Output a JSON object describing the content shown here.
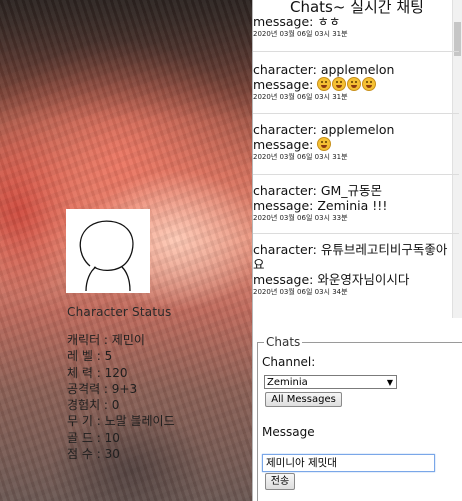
{
  "chat": {
    "header": "Chats~ 실시간 채팅",
    "messages": [
      {
        "character": "",
        "message": "message: ㅎㅎ",
        "time": "2020년 03월 06일 03시 31분"
      },
      {
        "character": "character: applemelon",
        "message": "message: ",
        "emoji": [
          "grinning-emoji",
          "grinning-emoji",
          "grinning-emoji",
          "grinning-emoji"
        ],
        "time": "2020년 03월 06일 03시 31분"
      },
      {
        "character": "character: applemelon",
        "message": "message: ",
        "emoji": [
          "cat-emoji"
        ],
        "time": "2020년 03월 06일 03시 31분"
      },
      {
        "character": "character: GM_규동몬",
        "message": "message: Zeminia !!!",
        "time": "2020년 03월 06일 03시 33분"
      },
      {
        "character": "character: 유튜브레고티비구독좋아요",
        "message": "message: 와운영자님이시다",
        "time": "2020년 03월 06일 03시 34분"
      }
    ],
    "form": {
      "legend": "Chats",
      "channel_label": "Channel:",
      "channel_value": "Zeminia",
      "all_messages_label": "All Messages",
      "message_label": "Message",
      "message_value": "제미니아 제밋대",
      "send_label": "전송"
    }
  },
  "character": {
    "status_title": "Character Status",
    "stats": [
      "캐릭터 : 제민이",
      "레 벨 : 5",
      "체 력 : 120",
      "공격력 : 9+3",
      "경험치 : 0",
      "무 기 : 노말 블레이드",
      "골 드 : 10",
      "점 수 : 30"
    ]
  },
  "colors": {
    "background_accent": "#d3705c",
    "input_focus": "#7aa7e8"
  }
}
